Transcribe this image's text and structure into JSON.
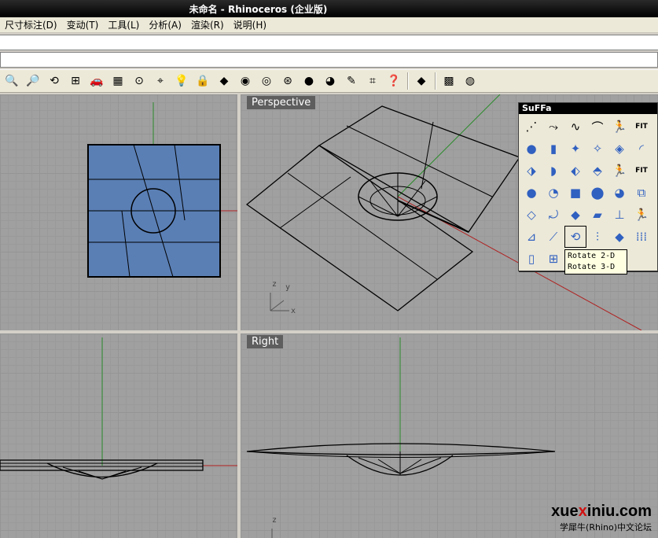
{
  "window": {
    "title": "未命名 - Rhinoceros (企业版)"
  },
  "menu": [
    "尺寸标注(D)",
    "变动(T)",
    "工具(L)",
    "分析(A)",
    "渲染(R)",
    "说明(H)"
  ],
  "command": {
    "input": ""
  },
  "toolbar": {
    "icons": [
      "zoom-window-icon",
      "zoom-dynamic-icon",
      "rotate-view-icon",
      "four-viewports-icon",
      "car-icon",
      "grid-plane-icon",
      "cplane-icon",
      "snap-icon",
      "lightbulb-icon",
      "lock-icon",
      "layer-icon",
      "color-wheel-icon",
      "sphere-wire-icon",
      "sphere-mesh-icon",
      "sphere-render-icon",
      "pencil-icon",
      "points-icon",
      "help-icon",
      "version-icon",
      "render-icon",
      "material-icon",
      "sound-icon"
    ]
  },
  "viewports": {
    "top": {
      "label": ""
    },
    "perspective": {
      "label": "Perspective"
    },
    "front": {
      "label": ""
    },
    "right": {
      "label": "Right"
    }
  },
  "axes": {
    "x": "x",
    "y": "y",
    "z": "z"
  },
  "suffa": {
    "title": "SuFFa",
    "tooltip": [
      "Rotate 2-D",
      "Rotate 3-D"
    ],
    "fit_label": "FIT"
  },
  "watermark": {
    "site_pre": "xue",
    "site_x": "x",
    "site_post": "iniu.com",
    "sub": "学犀牛(Rhino)中文论坛"
  },
  "colors": {
    "axis_green": "#2a8a2a",
    "axis_red": "#b02020",
    "surface_blue": "#5a7fb5",
    "viewport_bg": "#a0a0a0"
  }
}
